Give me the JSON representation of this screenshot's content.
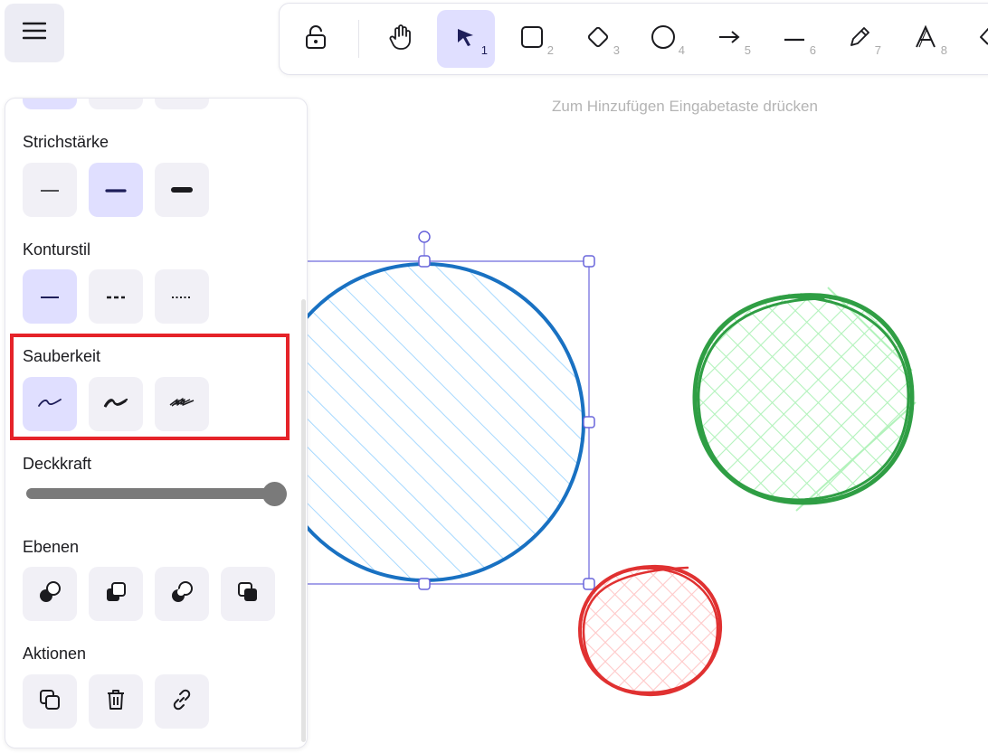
{
  "app": {
    "hint_text": "Zum Hinzufügen Eingabetaste drücken",
    "accent_color": "#e0dfff",
    "annotation_color": "#e52329"
  },
  "toolbar": {
    "tools": [
      {
        "name": "lock-icon",
        "number": ""
      },
      {
        "name": "hand-icon",
        "number": ""
      },
      {
        "name": "selection-arrow-icon",
        "number": "1",
        "active": true
      },
      {
        "name": "rectangle-icon",
        "number": "2"
      },
      {
        "name": "diamond-icon",
        "number": "3"
      },
      {
        "name": "ellipse-icon",
        "number": "4"
      },
      {
        "name": "arrow-icon",
        "number": "5"
      },
      {
        "name": "line-icon",
        "number": "6"
      },
      {
        "name": "pencil-icon",
        "number": "7"
      },
      {
        "name": "text-icon",
        "number": "8"
      },
      {
        "name": "eraser-icon",
        "number": ""
      }
    ]
  },
  "panel": {
    "stroke_width": {
      "label": "Strichstärke",
      "options": [
        "thin",
        "bold",
        "extra-bold"
      ],
      "selected": "bold"
    },
    "stroke_style": {
      "label": "Konturstil",
      "options": [
        "solid",
        "dashed",
        "dotted"
      ],
      "selected": "solid"
    },
    "sloppiness": {
      "label": "Sauberkeit",
      "options": [
        "architect",
        "artist",
        "cartoonist"
      ],
      "selected": "architect"
    },
    "opacity": {
      "label": "Deckkraft",
      "value": 100
    },
    "layers": {
      "label": "Ebenen",
      "options": [
        "send-to-back",
        "send-backward",
        "bring-forward",
        "bring-to-front"
      ]
    },
    "actions": {
      "label": "Aktionen",
      "options": [
        "duplicate",
        "delete",
        "link"
      ]
    }
  },
  "canvas": {
    "shapes": [
      {
        "type": "ellipse",
        "stroke": "#1971c2",
        "fill": "#a5d8ff",
        "fill_style": "hachure",
        "selected": true
      },
      {
        "type": "ellipse",
        "stroke": "#2f9e44",
        "fill": "#b2f2bb",
        "fill_style": "cross-hatch"
      },
      {
        "type": "ellipse",
        "stroke": "#e03131",
        "fill": "#ffc9c9",
        "fill_style": "cross-hatch"
      }
    ],
    "selection_color": "#6965db"
  }
}
